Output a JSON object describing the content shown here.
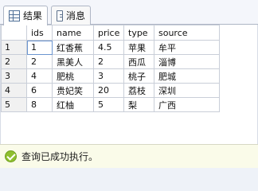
{
  "tabs": [
    {
      "label": "结果",
      "icon": "grid-icon",
      "active": true
    },
    {
      "label": "消息",
      "icon": "message-icon",
      "active": false
    }
  ],
  "table": {
    "columns": [
      "",
      "ids",
      "name",
      "price",
      "type",
      "source"
    ],
    "rows": [
      {
        "rownum": "1",
        "ids": "1",
        "name": "红香蕉",
        "price": "4.5",
        "type": "苹果",
        "source": "牟平"
      },
      {
        "rownum": "2",
        "ids": "2",
        "name": "黑美人",
        "price": "2",
        "type": "西瓜",
        "source": "淄博"
      },
      {
        "rownum": "3",
        "ids": "4",
        "name": "肥桃",
        "price": "3",
        "type": "桃子",
        "source": "肥城"
      },
      {
        "rownum": "4",
        "ids": "6",
        "name": "贵妃笑",
        "price": "20",
        "type": "荔枝",
        "source": "深圳"
      },
      {
        "rownum": "5",
        "ids": "8",
        "name": "红柚",
        "price": "5",
        "type": "梨",
        "source": "广西"
      }
    ]
  },
  "status": {
    "text": "查询已成功执行。",
    "icon": "check-circle-icon",
    "color": "#8fbf2f"
  }
}
